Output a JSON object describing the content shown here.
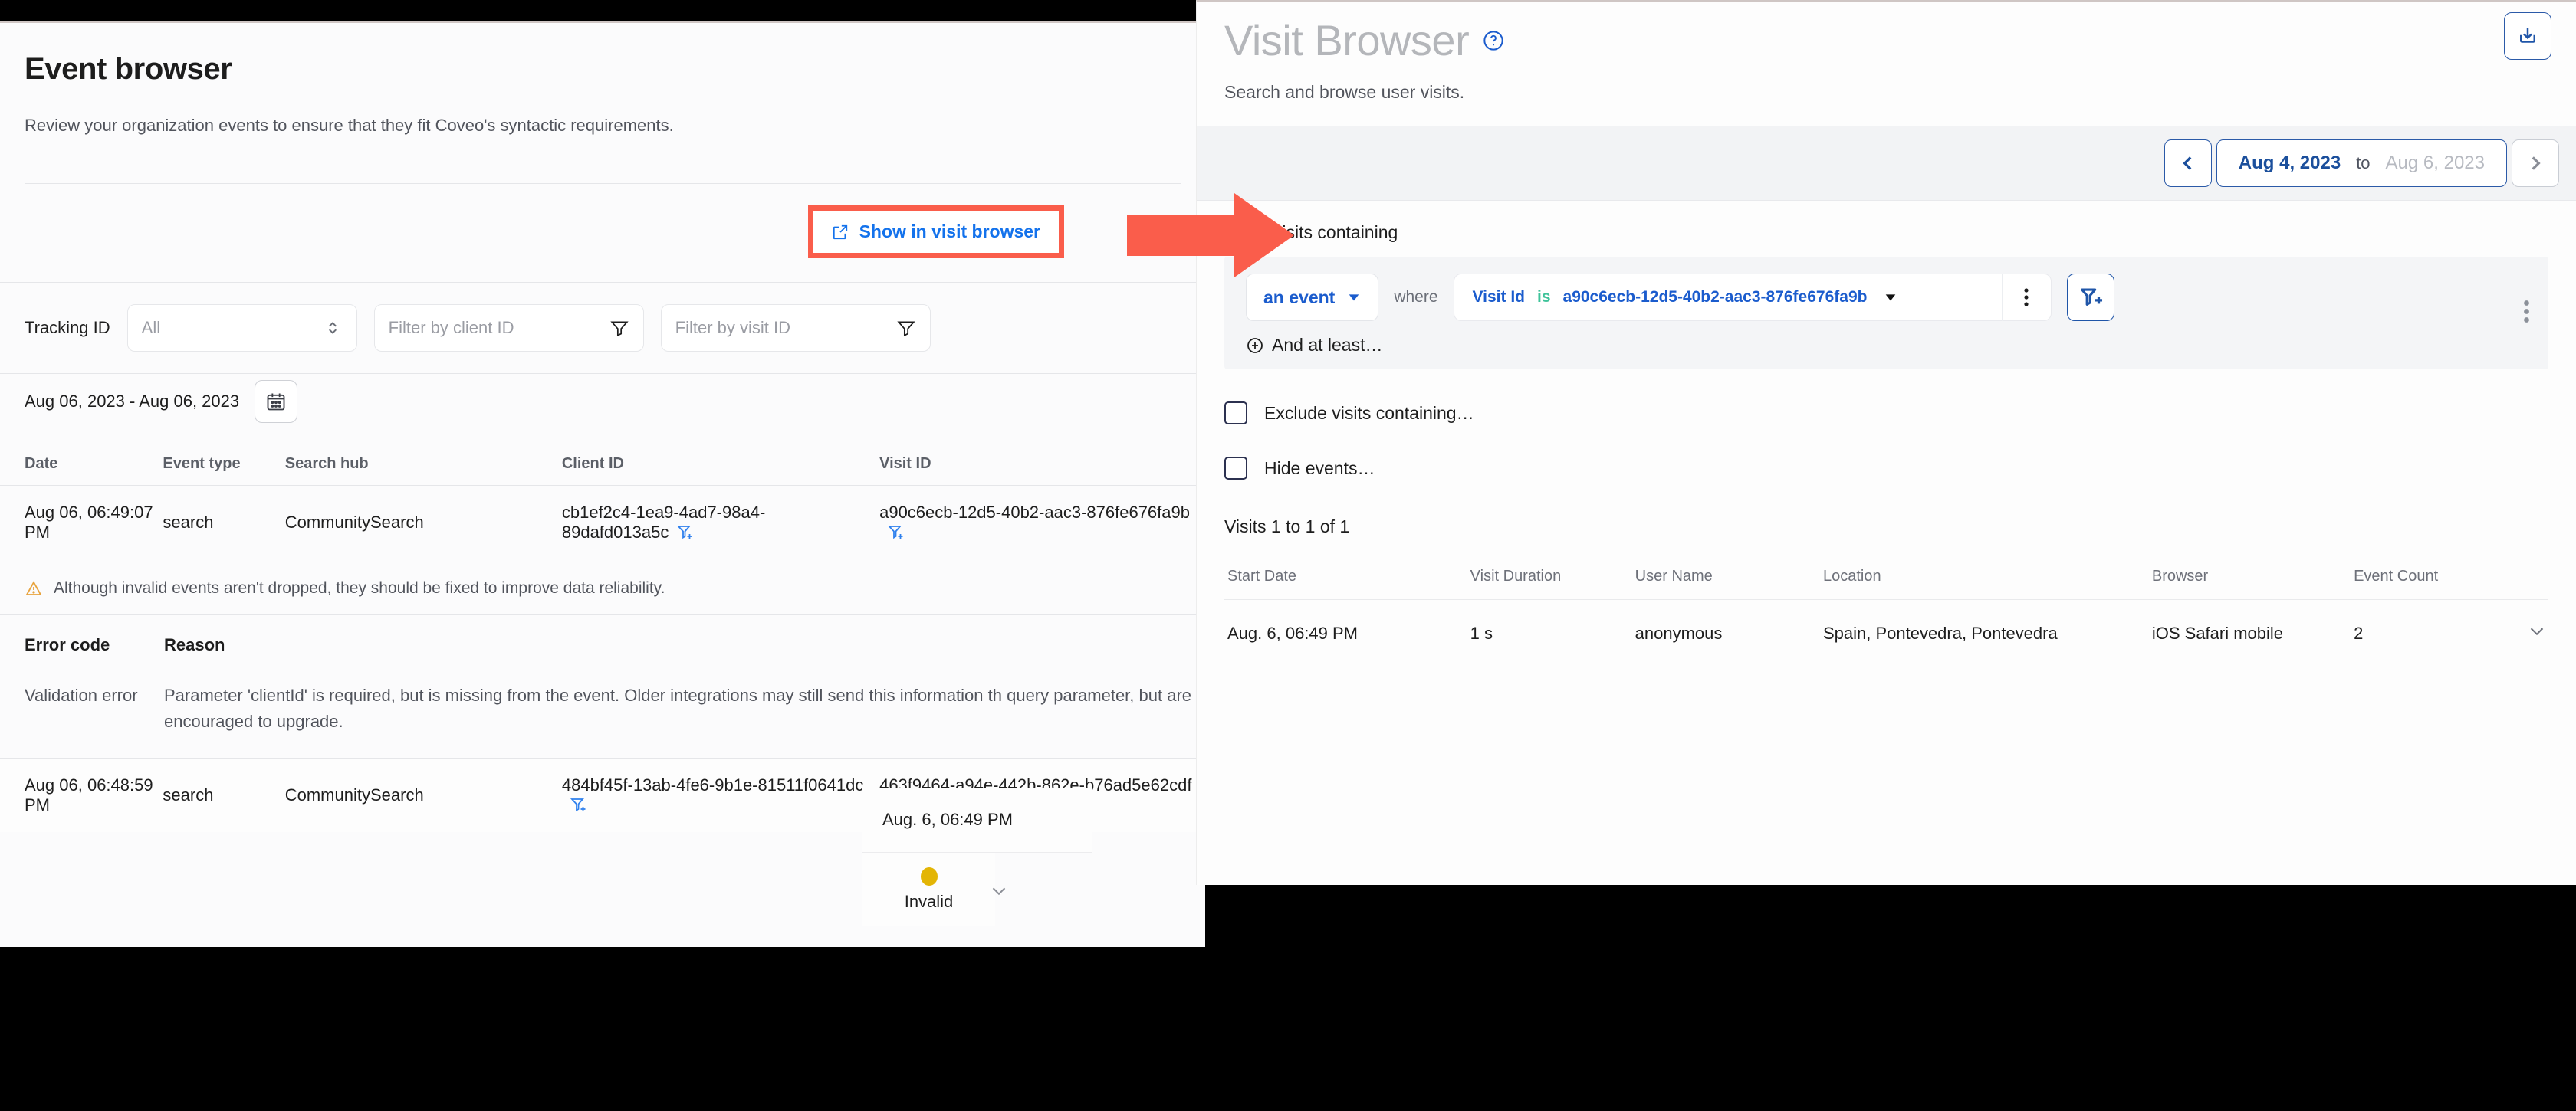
{
  "event_browser": {
    "title": "Event browser",
    "subtitle": "Review your organization events to ensure that they fit Coveo's syntactic requirements.",
    "show_in_visit_browser": "Show in visit browser",
    "show_in_visit_browser_icon": "external-link-icon",
    "tracking_id_label": "Tracking ID",
    "tracking_id_value": "All",
    "client_id_placeholder": "Filter by client ID",
    "visit_id_placeholder": "Filter by visit ID",
    "date_range": "Aug 06, 2023 - Aug 06, 2023",
    "calendar_icon": "calendar-icon",
    "columns": [
      "Date",
      "Event type",
      "Search hub",
      "Client ID",
      "Visit ID"
    ],
    "rows": [
      {
        "date": "Aug 06, 06:49:07 PM",
        "event_type": "search",
        "search_hub": "CommunitySearch",
        "client_id": "cb1ef2c4-1ea9-4ad7-98a4-89dafd013a5c",
        "visit_id": "a90c6ecb-12d5-40b2-aac3-876fe676fa9b"
      },
      {
        "date": "Aug 06, 06:48:59 PM",
        "event_type": "search",
        "search_hub": "CommunitySearch",
        "client_id": "484bf45f-13ab-4fe6-9b1e-81511f0641dc",
        "visit_id": "463f9464-a94e-442b-862e-b76ad5e62cdf"
      }
    ],
    "warning": "Although invalid events aren't dropped, they should be fixed to improve data reliability.",
    "warning_icon": "warning-triangle-icon",
    "error_columns": [
      "Error code",
      "Reason"
    ],
    "error_row": {
      "code": "Validation error",
      "reason": "Parameter 'clientId' is required, but is missing from the event. Older integrations may still send this information th query parameter, but are encouraged to upgrade."
    },
    "status": {
      "label": "Invalid",
      "dot_color": "#e3b505",
      "floating_date": "Aug. 6, 06:49 PM"
    }
  },
  "visit_browser": {
    "title": "Visit Browser",
    "help_icon": "help-circle-icon",
    "subtitle": "Search and browse user visits.",
    "export_icon": "download-box-icon",
    "date_nav": {
      "prev_icon": "chevron-left-icon",
      "next_icon": "chevron-right-icon",
      "from": "Aug 4, 2023",
      "to_label": "to",
      "to": "Aug 6, 2023"
    },
    "show_visits_label": "Show visits containing",
    "query": {
      "scope": "an event",
      "scope_caret_icon": "caret-down-icon",
      "where_label": "where",
      "field": "Visit Id",
      "operator": "is",
      "value": "a90c6ecb-12d5-40b2-aac3-876fe676fa9b",
      "value_caret_icon": "caret-down-icon",
      "kebab_icon": "kebab-menu-icon",
      "add_filter_icon": "filter-add-icon",
      "group_kebab_icon": "kebab-menu-icon",
      "and_at_least": "And at least…",
      "and_at_least_icon": "plus-circle-icon"
    },
    "exclude_label": "Exclude visits containing…",
    "hide_events_label": "Hide events…",
    "visits_count": "Visits 1 to 1 of 1",
    "columns": [
      "Start Date",
      "Visit Duration",
      "User Name",
      "Location",
      "Browser",
      "Event Count",
      ""
    ],
    "rows": [
      {
        "start_date": "Aug. 6, 06:49 PM",
        "visit_duration": "1 s",
        "user_name": "anonymous",
        "location": "Spain, Pontevedra, Pontevedra",
        "browser": "iOS Safari mobile",
        "event_count": "2",
        "expand_icon": "chevron-down-icon"
      }
    ]
  },
  "annotation": {
    "highlight_color": "#fa5d4b",
    "arrow_icon": "right-arrow-annotation"
  }
}
